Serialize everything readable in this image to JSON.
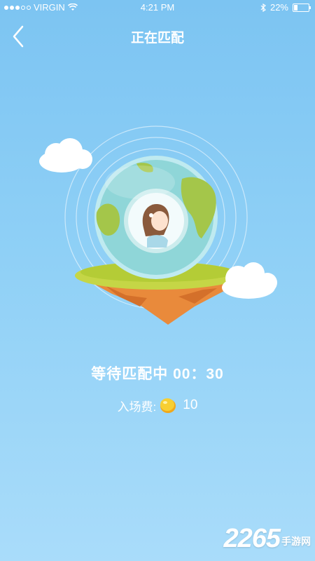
{
  "status_bar": {
    "carrier": "VIRGIN",
    "time": "4:21 PM",
    "battery_percent": "22%",
    "battery_level": 0.22,
    "icons": [
      "signal-dots",
      "wifi-icon",
      "bluetooth-icon",
      "battery-icon"
    ]
  },
  "nav": {
    "back_icon": "chevron-left-icon",
    "title": "正在匹配"
  },
  "match": {
    "status_label": "等待匹配中",
    "timer": "00：30",
    "fee_label": "入场费:",
    "fee_icon": "coin-icon",
    "fee_value": "10"
  },
  "watermark": {
    "digits": "2265",
    "text": "手游网"
  },
  "colors": {
    "background_top": "#7cc4f2",
    "background_bottom": "#a9dcfa",
    "text": "#ffffff",
    "coin": "#f5c518"
  }
}
